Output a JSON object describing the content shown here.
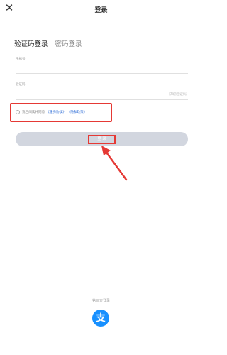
{
  "header": {
    "close_glyph": "✕",
    "title": "登录"
  },
  "tabs": [
    {
      "label": "验证码登录",
      "active": true
    },
    {
      "label": "密码登录",
      "active": false
    }
  ],
  "phone_field": {
    "label": "手机号"
  },
  "code_field": {
    "label": "验证码",
    "action": "获取验证码"
  },
  "agreement": {
    "prefix": "我已阅读并同意",
    "service_link": "《服务协议》",
    "privacy_link": "《隐私政策》"
  },
  "login_button": {
    "label": "登 录"
  },
  "third_party": {
    "label": "第三方登录",
    "alipay_glyph": "支"
  },
  "colors": {
    "annotation": "#e53935",
    "alipay": "#1890ff",
    "link": "#2d6cd6",
    "button_disabled": "#d2d6df"
  },
  "icons": [
    "close-icon",
    "radio-icon",
    "alipay-icon",
    "annotation-arrow-icon"
  ]
}
